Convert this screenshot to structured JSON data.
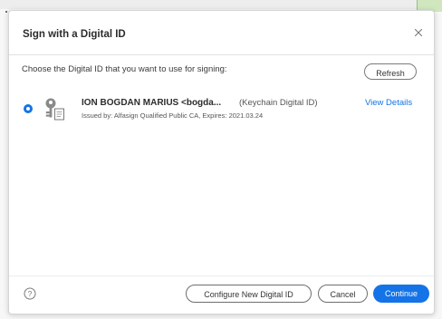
{
  "dialog": {
    "title": "Sign with a Digital ID",
    "close_icon": "close-icon",
    "instruction": "Choose the Digital ID that you want to use for signing:",
    "refresh_label": "Refresh"
  },
  "digital_ids": [
    {
      "name": "ION BOGDAN MARIUS <bogda...",
      "type": "(Keychain Digital ID)",
      "issued": "Issued by: Alfasign Qualified Public CA, Expires: 2021.03.24",
      "view_details_label": "View Details",
      "selected": true,
      "icon": "key-certificate-icon"
    }
  ],
  "footer": {
    "help_icon": "help-icon",
    "configure_label": "Configure New Digital ID",
    "cancel_label": "Cancel",
    "continue_label": "Continue"
  },
  "colors": {
    "accent": "#1473e6",
    "title_text": "#2c2c2c",
    "dialog_bg": "#ffffff"
  }
}
